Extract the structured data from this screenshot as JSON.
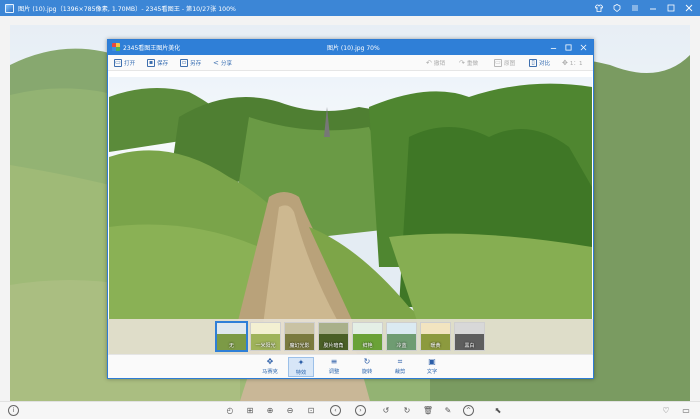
{
  "outer": {
    "title": "图片 (10).jpg（1396×785像素, 1.70MB）- 2345看图王 - 第10/27张 100%"
  },
  "outer_controls": {
    "icons": [
      "shirt-icon",
      "skin-icon",
      "menu-icon",
      "minimize-icon",
      "maximize-icon",
      "close-icon"
    ]
  },
  "dialog": {
    "app_name": "2345看图王图片美化",
    "file_title": "图片 (10).jpg  70%",
    "toolbar": {
      "open": "打开",
      "save": "保存",
      "save_as": "另存",
      "share": "分享",
      "undo": "撤销",
      "redo": "重做",
      "original": "原图",
      "compare": "对比",
      "ratio": "1：1"
    },
    "filters": [
      {
        "label": "无",
        "selected": true
      },
      {
        "label": "一米阳光",
        "selected": false
      },
      {
        "label": "魔幻光影",
        "selected": false
      },
      {
        "label": "胶片暗角",
        "selected": false
      },
      {
        "label": "鲜艳",
        "selected": false
      },
      {
        "label": "冷蓝",
        "selected": false
      },
      {
        "label": "暖黄",
        "selected": false
      },
      {
        "label": "黑白",
        "selected": false
      }
    ],
    "tools": [
      {
        "label": "马赛克",
        "active": false
      },
      {
        "label": "特效",
        "active": true
      },
      {
        "label": "调整",
        "active": false
      },
      {
        "label": "旋转",
        "active": false
      },
      {
        "label": "裁剪",
        "active": false
      },
      {
        "label": "文字",
        "active": false
      }
    ]
  },
  "colors": {
    "titlebar": "#3c86d6",
    "dialog_titlebar": "#2f7fd7",
    "toolbar_text": "#2f68b0"
  }
}
